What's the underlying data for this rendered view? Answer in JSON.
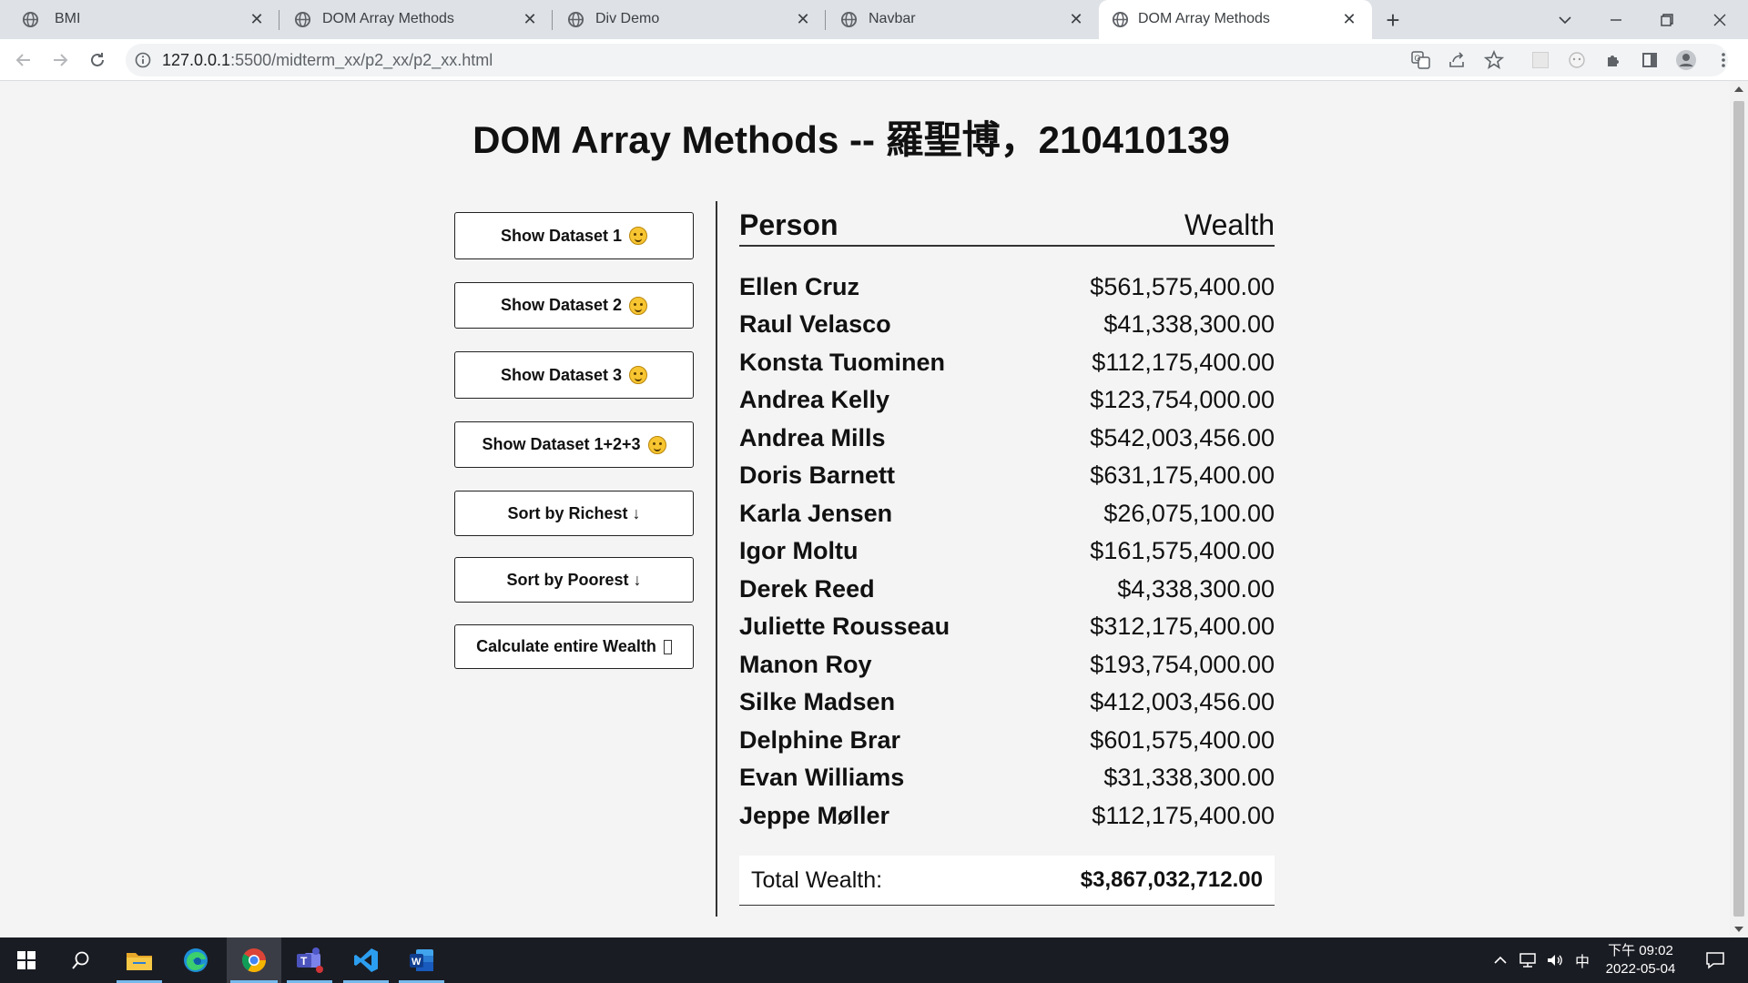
{
  "browser": {
    "tabs": [
      {
        "title": "BMI",
        "active": false
      },
      {
        "title": "DOM Array Methods",
        "active": false
      },
      {
        "title": "Div Demo",
        "active": false
      },
      {
        "title": "Navbar",
        "active": false
      },
      {
        "title": "DOM Array Methods",
        "active": true
      }
    ],
    "url_host": "127.0.0.1",
    "url_path": ":5500/midterm_xx/p2_xx/p2_xx.html"
  },
  "page": {
    "title": "DOM Array Methods -- 羅聖博，210410139",
    "buttons": {
      "dataset1": "Show Dataset 1",
      "dataset2": "Show Dataset 2",
      "dataset3": "Show Dataset 3",
      "dataset_all": "Show Dataset 1+2+3",
      "sort_richest": "Sort by Richest ↓",
      "sort_poorest": "Sort by Poorest ↓",
      "calc_wealth": "Calculate entire Wealth"
    },
    "table": {
      "header_person": "Person",
      "header_wealth": "Wealth",
      "rows": [
        {
          "name": "Ellen Cruz",
          "wealth": "$561,575,400.00"
        },
        {
          "name": "Raul Velasco",
          "wealth": "$41,338,300.00"
        },
        {
          "name": "Konsta Tuominen",
          "wealth": "$112,175,400.00"
        },
        {
          "name": "Andrea Kelly",
          "wealth": "$123,754,000.00"
        },
        {
          "name": "Andrea Mills",
          "wealth": "$542,003,456.00"
        },
        {
          "name": "Doris Barnett",
          "wealth": "$631,175,400.00"
        },
        {
          "name": "Karla Jensen",
          "wealth": "$26,075,100.00"
        },
        {
          "name": "Igor Moltu",
          "wealth": "$161,575,400.00"
        },
        {
          "name": "Derek Reed",
          "wealth": "$4,338,300.00"
        },
        {
          "name": "Juliette Rousseau",
          "wealth": "$312,175,400.00"
        },
        {
          "name": "Manon Roy",
          "wealth": "$193,754,000.00"
        },
        {
          "name": "Silke Madsen",
          "wealth": "$412,003,456.00"
        },
        {
          "name": "Delphine Brar",
          "wealth": "$601,575,400.00"
        },
        {
          "name": "Evan Williams",
          "wealth": "$31,338,300.00"
        },
        {
          "name": "Jeppe Møller",
          "wealth": "$112,175,400.00"
        }
      ],
      "total_label": "Total Wealth:",
      "total_value": "$3,867,032,712.00"
    }
  },
  "taskbar": {
    "ime": "中",
    "time": "下午 09:02",
    "date": "2022-05-04"
  },
  "colors": {
    "accent_blue": "#76b9ed",
    "taskbar_bg": "#1a1c23",
    "tabstrip_bg": "#dee1e6",
    "page_bg": "#f4f4f4"
  }
}
